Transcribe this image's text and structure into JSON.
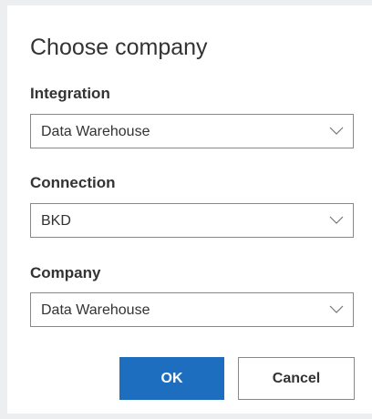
{
  "dialog": {
    "title": "Choose company"
  },
  "fields": {
    "integration": {
      "label": "Integration",
      "value": "Data Warehouse"
    },
    "connection": {
      "label": "Connection",
      "value": "BKD"
    },
    "company": {
      "label": "Company",
      "value": "Data Warehouse"
    }
  },
  "buttons": {
    "ok_label": "OK",
    "cancel_label": "Cancel"
  },
  "icons": {
    "dropdown": "chevron-down-icon"
  },
  "colors": {
    "primary": "#1e6ec0",
    "border": "#8a8886",
    "background": "#eceeef"
  }
}
